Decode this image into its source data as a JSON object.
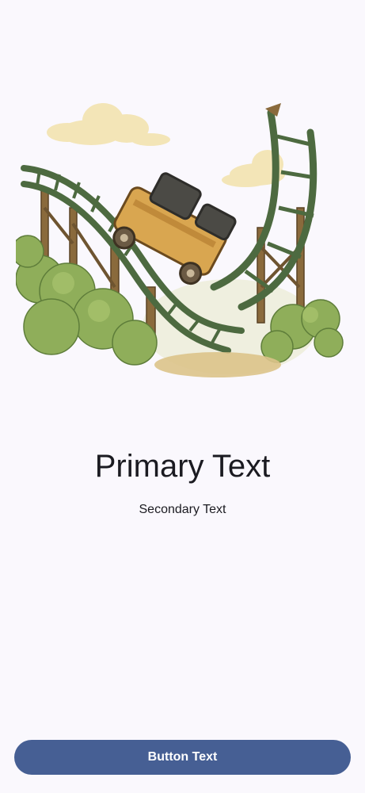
{
  "main": {
    "illustration_icon": "broken-roller-coaster-illustration",
    "primary_text": "Primary Text",
    "secondary_text": "Secondary Text"
  },
  "footer": {
    "button_label": "Button Text"
  },
  "colors": {
    "background": "#faf8fd",
    "button": "#465f94",
    "button_text": "#ffffff",
    "text": "#1b1b21"
  }
}
